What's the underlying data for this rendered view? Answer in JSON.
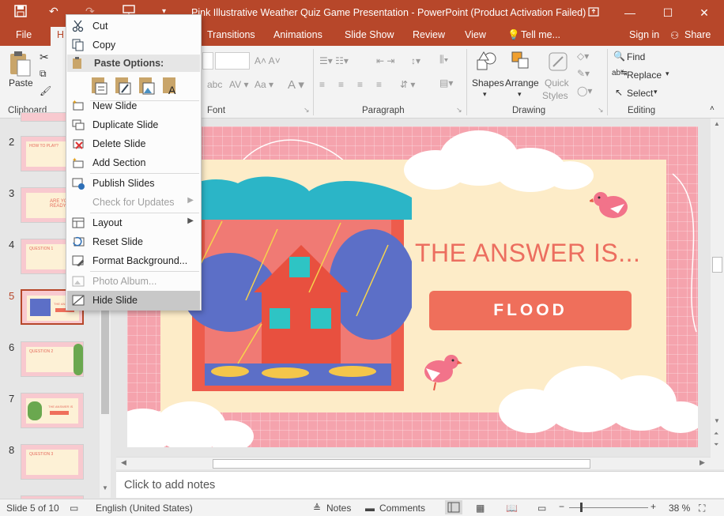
{
  "window": {
    "title": "Pink Illustrative Weather Quiz Game Presentation - PowerPoint (Product Activation Failed)"
  },
  "tabs": [
    "File",
    "H",
    "Transitions",
    "Animations",
    "Slide Show",
    "Review",
    "View"
  ],
  "tell_me": "Tell me...",
  "account": {
    "sign_in": "Sign in",
    "share": "Share"
  },
  "ribbon": {
    "clipboard": {
      "paste": "Paste",
      "label": "Clipboard"
    },
    "font": {
      "label": "Font"
    },
    "paragraph": {
      "label": "Paragraph"
    },
    "drawing": {
      "shapes": "Shapes",
      "arrange": "Arrange",
      "quick_styles_1": "Quick",
      "quick_styles_2": "Styles",
      "label": "Drawing"
    },
    "editing": {
      "find": "Find",
      "replace": "Replace",
      "select": "Select",
      "label": "Editing"
    }
  },
  "context_menu": {
    "cut": "Cut",
    "copy": "Copy",
    "paste_options": "Paste Options:",
    "new_slide": "New Slide",
    "duplicate_slide": "Duplicate Slide",
    "delete_slide": "Delete Slide",
    "add_section": "Add Section",
    "publish_slides": "Publish Slides",
    "check_updates": "Check for Updates",
    "layout": "Layout",
    "reset_slide": "Reset Slide",
    "format_background": "Format Background...",
    "photo_album": "Photo Album...",
    "hide_slide": "Hide Slide"
  },
  "thumbnails": [
    {
      "num": "2",
      "title": "HOW TO PLAY?"
    },
    {
      "num": "3",
      "title": "ARE YOU READY?"
    },
    {
      "num": "4",
      "title": "QUESTION 1"
    },
    {
      "num": "5",
      "title": "THE ANSWER IS"
    },
    {
      "num": "6",
      "title": "QUESTION 2"
    },
    {
      "num": "7",
      "title": "THE ANSWER IS"
    },
    {
      "num": "8",
      "title": "QUESTION 3"
    }
  ],
  "slide": {
    "headline": "THE ANSWER IS...",
    "answer": "FLOOD"
  },
  "notes_placeholder": "Click to add notes",
  "status": {
    "slide_of": "Slide 5 of 10",
    "language": "English (United States)",
    "notes": "Notes",
    "comments": "Comments",
    "zoom": "38 %"
  },
  "colors": {
    "accent": "#b7472a",
    "slide_bg": "#f5a3ad",
    "card": "#fdecc8",
    "answer_text": "#ec6e5f",
    "answer_button": "#ef6f5b"
  }
}
